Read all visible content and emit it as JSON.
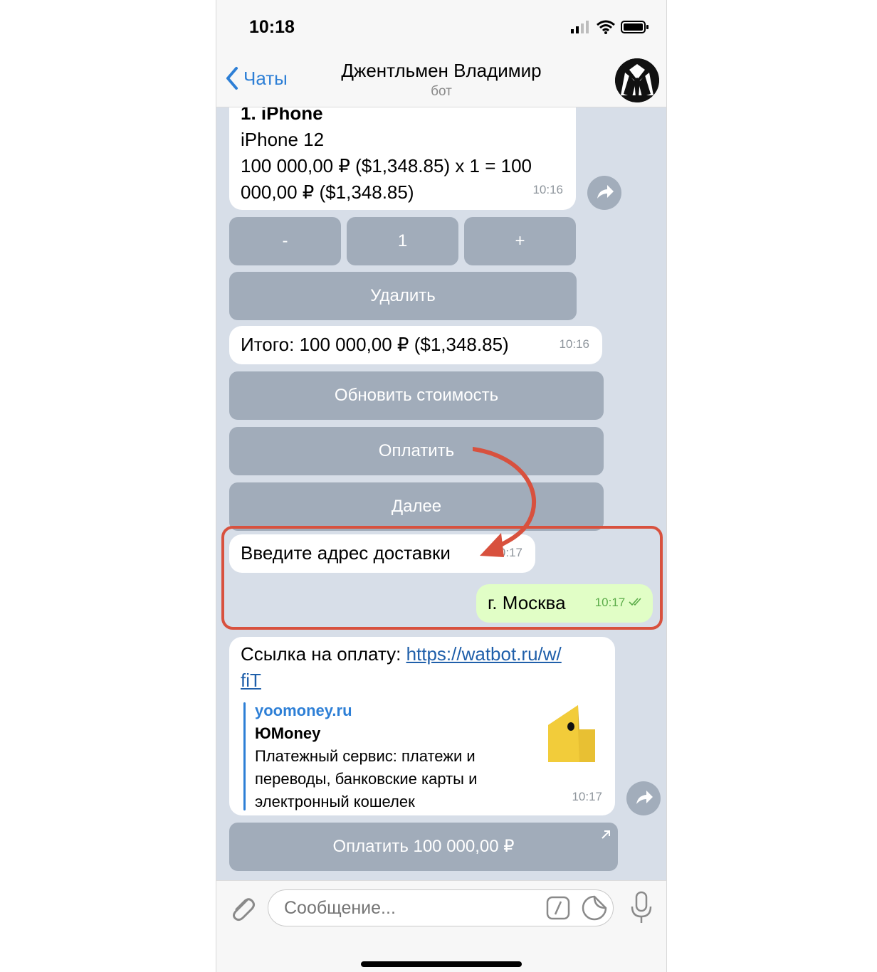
{
  "status_bar": {
    "time": "10:18"
  },
  "header": {
    "back_label": "Чаты",
    "title": "Джентльмен Владимир",
    "subtitle": "бот"
  },
  "messages": {
    "cart_item": {
      "line1": "1. iPhone",
      "line2": "iPhone 12",
      "line3": "100 000,00 ₽ ($1,348.85) x 1 = 100",
      "line4": "000,00 ₽ ($1,348.85)",
      "time": "10:16"
    },
    "qty_keyboard": {
      "minus": "-",
      "count": "1",
      "plus": "+",
      "delete": "Удалить"
    },
    "total": {
      "text": "Итого: 100 000,00 ₽ ($1,348.85)",
      "time": "10:16"
    },
    "total_keyboard": {
      "update": "Обновить стоимость",
      "pay": "Оплатить",
      "next": "Далее"
    },
    "address_prompt": {
      "text": "Введите адрес доставки",
      "time": "10:17"
    },
    "user_reply": {
      "text": "г. Москва",
      "time": "10:17"
    },
    "payment_link": {
      "prefix": "Ссылка на оплату: ",
      "url_line1": "https://watbot.ru/w/",
      "url_line2": "fiT",
      "preview_site": "yoomoney.ru",
      "preview_title": "ЮMoney",
      "preview_desc_1": "Платежный сервис: платежи и",
      "preview_desc_2": "переводы, банковские карты и",
      "preview_desc_3": "электронный кошелек",
      "time": "10:17"
    },
    "pay_button": {
      "label": "Оплатить 100 000,00 ₽"
    }
  },
  "composer": {
    "placeholder": "Сообщение..."
  },
  "colors": {
    "accent": "#2d7fd6",
    "highlight": "#d8513e",
    "chat_bg": "#d7dee8",
    "outgoing": "#e1fec6",
    "keyboard_button": "#8c98a8",
    "yoomoney": "#f2cc3a"
  },
  "icons": [
    "signal-icon",
    "wifi-icon",
    "battery-icon",
    "chevron-left-icon",
    "bot-avatar",
    "share-icon",
    "read-checks-icon",
    "external-link-icon",
    "attach-icon",
    "command-icon",
    "sticker-icon",
    "mic-icon",
    "yoomoney-wallet-icon",
    "annotation-arrow"
  ]
}
